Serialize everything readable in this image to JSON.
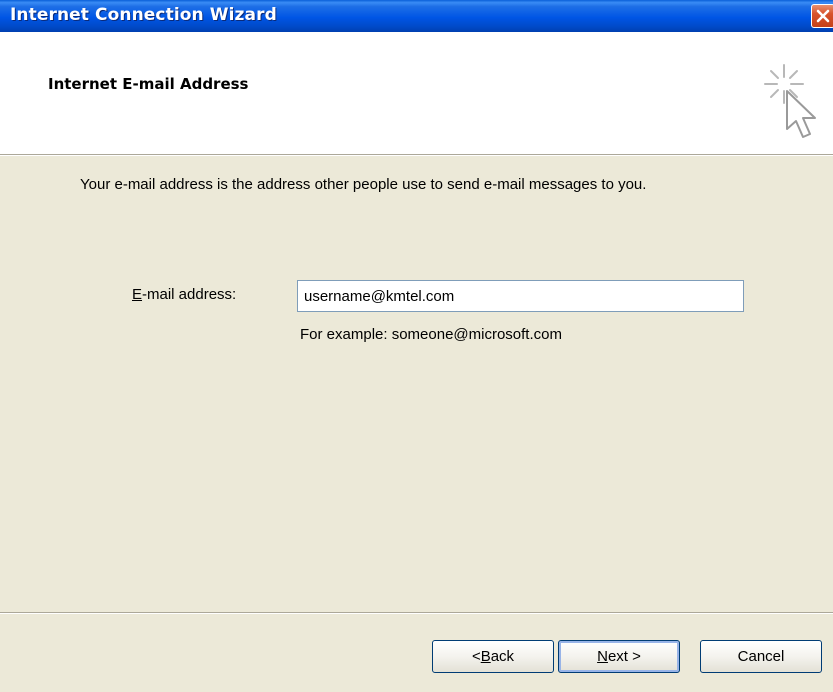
{
  "window": {
    "title": "Internet Connection Wizard",
    "close_icon": "close-icon"
  },
  "header": {
    "title": "Internet E-mail Address",
    "icon": "wizard-sparkle-cursor-icon"
  },
  "body": {
    "intro": "Your e-mail address is the address other people use to send e-mail messages to you.",
    "email_label": "E-mail address:",
    "email_label_access_key": "E",
    "email_label_rest": "-mail address:",
    "email_value": "username@kmtel.com",
    "example": "For example: someone@microsoft.com"
  },
  "buttons": {
    "back": "< Back",
    "back_prefix": "< ",
    "back_access_key": "B",
    "back_rest": "ack",
    "next": "Next >",
    "next_access_key": "N",
    "next_rest": "ext >",
    "cancel": "Cancel"
  },
  "colors": {
    "titlebar": "#0055e5",
    "dialog_bg": "#ece9d8",
    "close_button": "#d8532c",
    "input_border": "#7f9db9",
    "button_border": "#003c74"
  }
}
